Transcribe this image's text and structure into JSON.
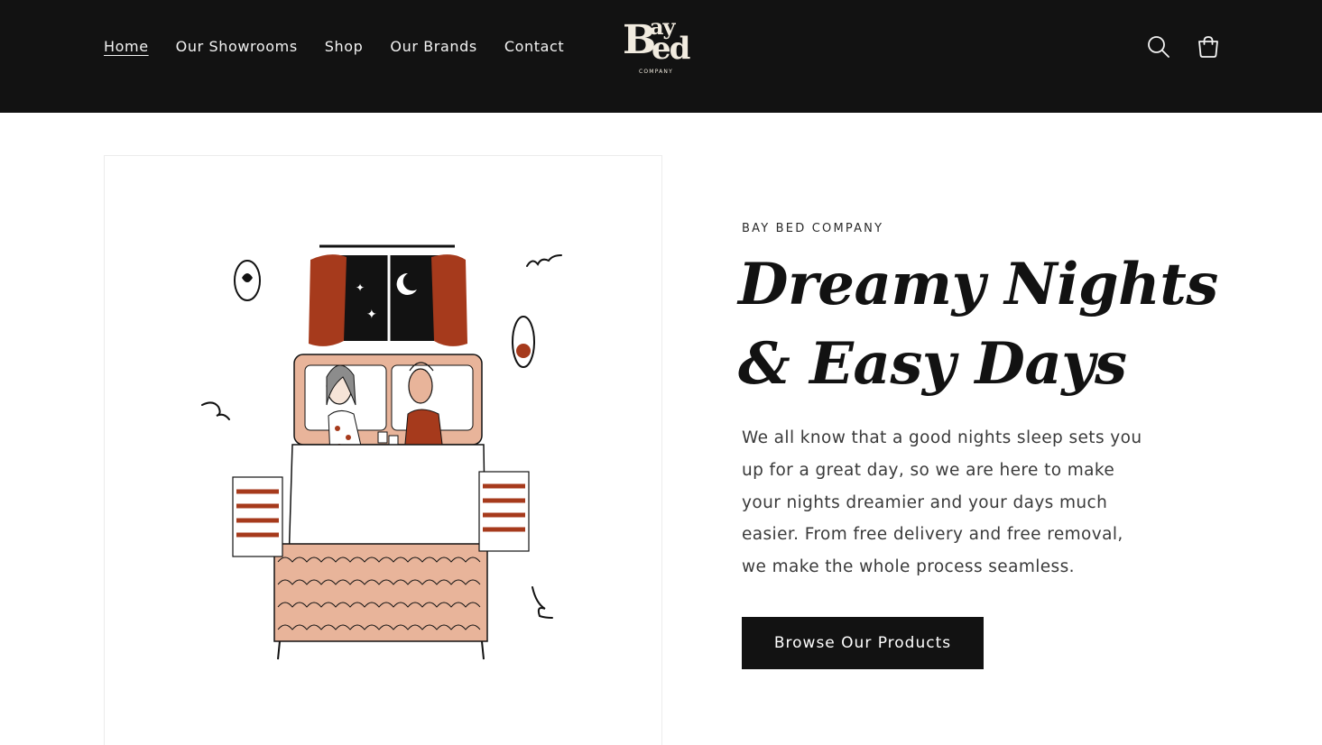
{
  "nav": {
    "items": [
      {
        "label": "Home",
        "active": true
      },
      {
        "label": "Our Showrooms"
      },
      {
        "label": "Shop"
      },
      {
        "label": "Our Brands"
      },
      {
        "label": "Contact"
      }
    ]
  },
  "logo": {
    "line1": "ay",
    "initial": "B",
    "line2": "ed",
    "tagline": "COMPANY"
  },
  "header_icons": [
    "search-icon",
    "cart-icon"
  ],
  "hero": {
    "eyebrow": "BAY BED COMPANY",
    "headline_line1": "Dreamy Nights",
    "headline_line2": "& Easy Days",
    "body": "We all know that a good nights sleep sets you up for a great day, so we are here to make your nights dreamier and your days much easier. From free delivery and free removal, we make the whole process seamless.",
    "cta_label": "Browse Our Products"
  },
  "colors": {
    "header_bg": "#121212",
    "accent_rust": "#a63a1c",
    "accent_peach": "#e8b49a",
    "button_bg": "#121212"
  }
}
